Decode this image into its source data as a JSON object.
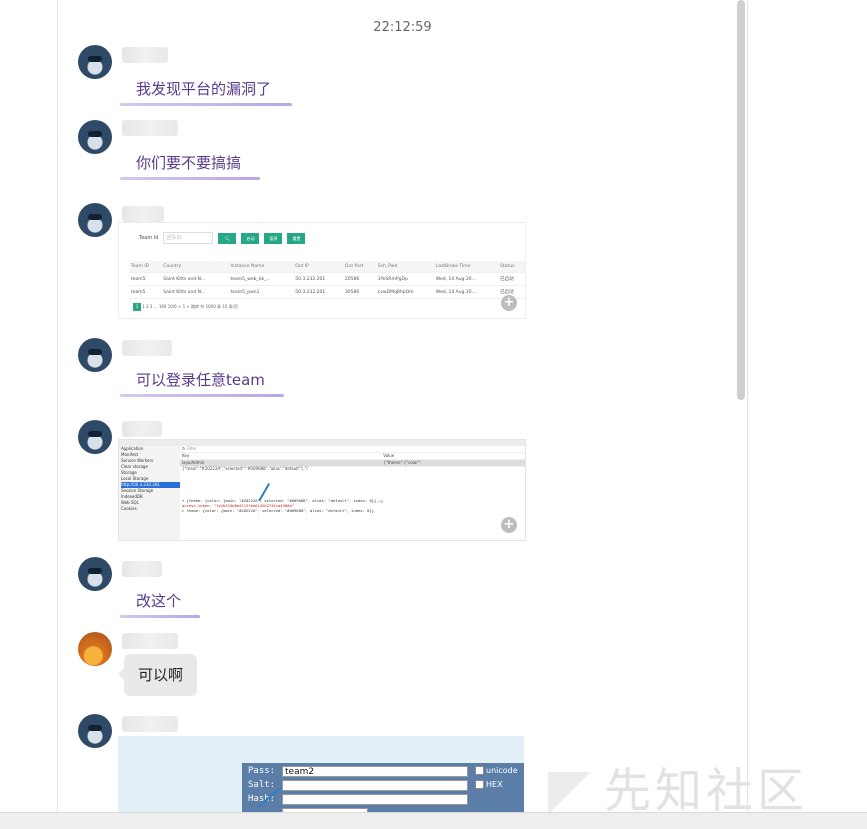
{
  "chat": {
    "timestamp": "22:12:59",
    "messages": [
      {
        "text": "我发现平台的漏洞了"
      },
      {
        "text": "你们要不要搞搞"
      },
      {
        "text": "可以登录任意team"
      },
      {
        "text": "改这个"
      },
      {
        "text": "可以啊"
      }
    ]
  },
  "screenshot1": {
    "team_id_label": "Team Id",
    "team_id_placeholder": "团队ID",
    "buttons": [
      "启动",
      "暂停",
      "重置"
    ],
    "columns": [
      "Team ID",
      "Country",
      "Instance Name",
      "Out IP",
      "Out Port",
      "Ssh_Pwd",
      "LastBroke Time",
      "Status"
    ],
    "rows": [
      [
        "team5",
        "Saint Kitts and N...",
        "team5_web_bk_...",
        "50.3.232.201",
        "20586",
        "3YeSRmPgDp",
        "Wed, 14 Aug 20...",
        "已启动"
      ],
      [
        "team5",
        "Saint Kitts and N...",
        "team5_pwn1",
        "50.3.232.201",
        "30586",
        "cvwDMqBhpOm",
        "Wed, 14 Aug 20...",
        "已启动"
      ]
    ],
    "pager": "1  2  3  ...  160    10/6  <   1   >  跳转   共 1600 条   10 条/页"
  },
  "screenshot2": {
    "sidebar": [
      "Application",
      "Manifest",
      "Service Workers",
      "Clear storage",
      "Storage",
      "Local Storage",
      "http://50.3.232.201",
      "Session Storage",
      "IndexedDB",
      "Web SQL",
      "Cookies"
    ],
    "filter_placeholder": "Filter",
    "key_header": "Key",
    "value_header": "Value",
    "key": "layuiAdmin",
    "value": "{\"theme\":{\"color\":{\"main\":\"#20222A\",\"selected\":\"#009688\",\"alias\":\"default\"},\"i",
    "console": [
      "▾ {theme: {color: {main: \"#20222A\", selected: \"#009688\", alias: \"default\", index: 0}},…}",
      "    access_token: \"1e2b315b8e4f12f6e6142b2734ca4580a\"",
      "  ▸ theme: {color: {main: \"#20222A\", selected: \"#009688\", alias: \"default\", index: 0}}"
    ]
  },
  "screenshot3": {
    "pass_label": "Pass:",
    "pass_value": "team2",
    "salt_label": "Salt:",
    "hash_label": "Hash:",
    "option_unicode": "unicode",
    "option_hex": "HEX"
  },
  "watermark": "先知社区",
  "colors": {
    "accent_text": "#5a3a8c",
    "underline": "#b9a6e4",
    "bubble": "#e9e9e9",
    "green_button": "#26a785"
  }
}
